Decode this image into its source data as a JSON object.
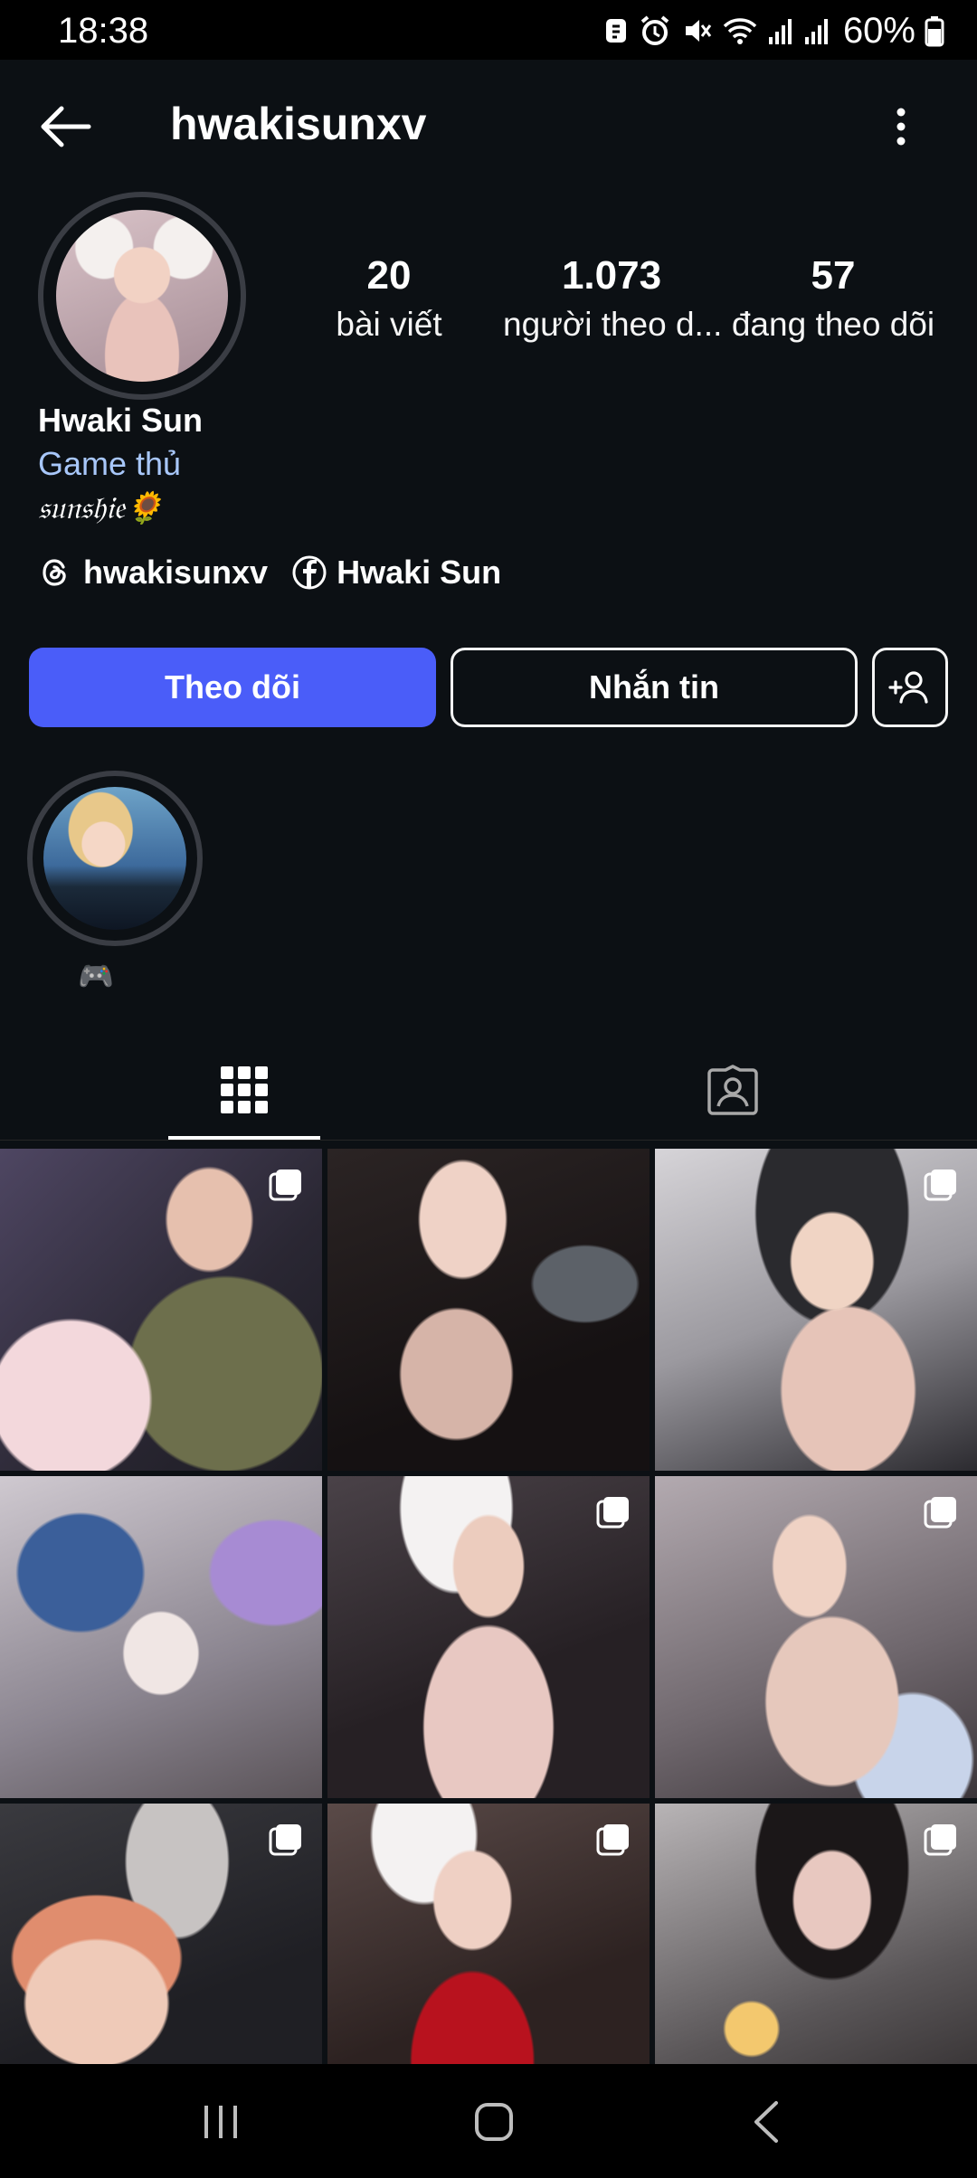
{
  "status_bar": {
    "time": "18:38",
    "battery": "60%"
  },
  "header": {
    "username": "hwakisunxv",
    "icons": [
      "back-arrow-icon",
      "more-vertical-icon"
    ]
  },
  "profile": {
    "display_name": "Hwaki Sun",
    "category": "Game thủ",
    "bio": "𝔰𝔲𝔫𝔰𝔥𝔦𝔢🌻",
    "stats": [
      {
        "value": "20",
        "label": "bài viết"
      },
      {
        "value": "1.073",
        "label": "người theo d..."
      },
      {
        "value": "57",
        "label": "đang theo dõi"
      }
    ],
    "links": [
      {
        "icon": "threads-icon",
        "label": "hwakisunxv"
      },
      {
        "icon": "facebook-icon",
        "label": "Hwaki Sun"
      }
    ]
  },
  "actions": {
    "follow": "Theo dõi",
    "message": "Nhắn tin"
  },
  "highlight": {
    "label": "🎮"
  },
  "tabs": [
    "grid-icon",
    "tagged-icon"
  ],
  "colors": {
    "background": "#0c1014",
    "follow_button": "#4a5df9",
    "category_text": "#a8c7fa"
  }
}
